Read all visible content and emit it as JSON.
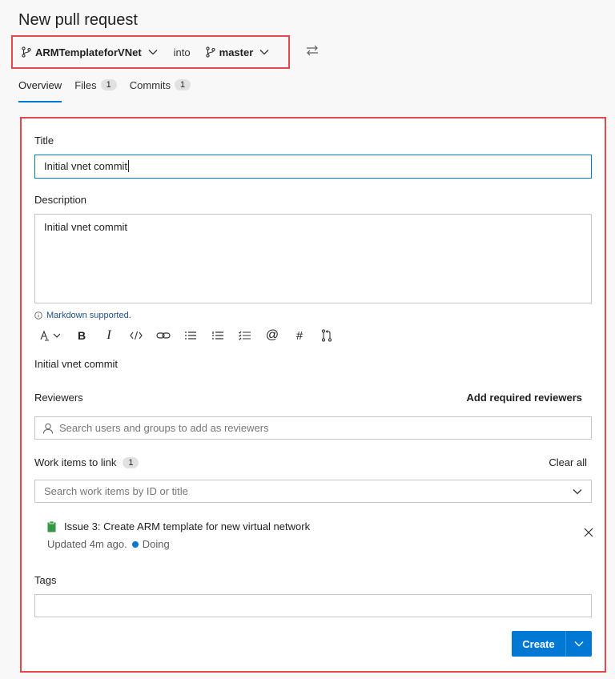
{
  "page": {
    "title": "New pull request"
  },
  "branches": {
    "source": "ARMTemplateforVNet",
    "into": "into",
    "target": "master"
  },
  "tabs": [
    {
      "label": "Overview"
    },
    {
      "label": "Files",
      "count": "1"
    },
    {
      "label": "Commits",
      "count": "1"
    }
  ],
  "form": {
    "title_label": "Title",
    "title_value": "Initial vnet commit",
    "description_label": "Description",
    "description_value": "Initial vnet commit",
    "markdown_note": "Markdown supported.",
    "preview_text": "Initial vnet commit",
    "reviewers_label": "Reviewers",
    "add_required_reviewers": "Add required reviewers",
    "reviewers_placeholder": "Search users and groups to add as reviewers",
    "work_items_label": "Work items to link",
    "work_items_count": "1",
    "clear_all": "Clear all",
    "work_items_placeholder": "Search work items by ID or title",
    "work_item": {
      "title": "Issue 3: Create ARM template for new virtual network",
      "updated": "Updated 4m ago.",
      "state": "Doing"
    },
    "tags_label": "Tags",
    "create_label": "Create"
  },
  "colors": {
    "accent": "#0078d4",
    "highlight_border": "#e5484d",
    "work_item_icon": "#339947"
  }
}
